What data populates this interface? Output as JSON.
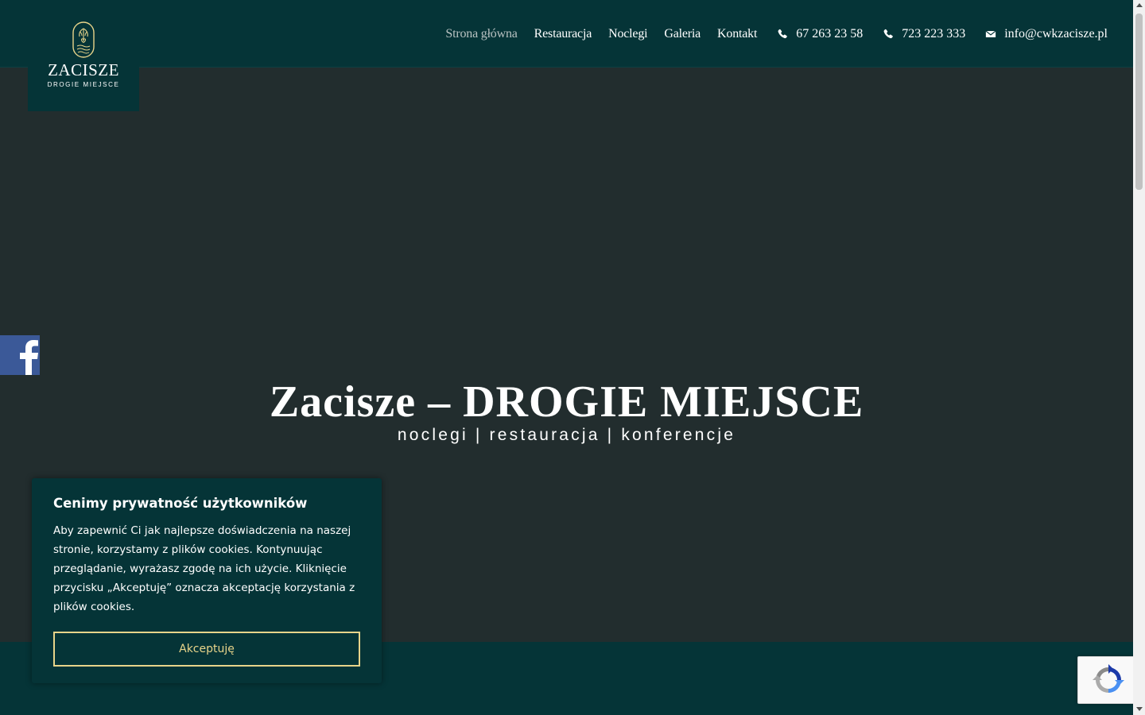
{
  "brand": {
    "name": "ZACISZE",
    "tagline": "DROGIE MIEJSCE"
  },
  "nav": {
    "items": [
      {
        "label": "Strona główna",
        "active": true
      },
      {
        "label": "Restauracja",
        "active": false
      },
      {
        "label": "Noclegi",
        "active": false
      },
      {
        "label": "Galeria",
        "active": false
      },
      {
        "label": "Kontakt",
        "active": false
      }
    ],
    "phone1": {
      "icon": "phone-icon",
      "label": "67 263 23 58"
    },
    "phone2": {
      "icon": "phone-icon",
      "label": "723 223 333"
    },
    "email": {
      "icon": "envelope-icon",
      "label": "info@cwkzacisze.pl"
    }
  },
  "hero": {
    "title": "Zacisze – DROGIE MIEJSCE",
    "subtitle": "noclegi | restauracja | konferencje"
  },
  "social": {
    "facebook_icon": "facebook-icon"
  },
  "cookie": {
    "title": "Cenimy prywatność użytkowników",
    "text": "Aby zapewnić Ci jak najlepsze doświadczenia na naszej stronie, korzystamy z plików cookies. Kontynuując przeglądanie, wyrażasz zgodę na ich użycie. Kliknięcie przycisku „Akceptuję” oznacza akceptację korzystania z plików cookies.",
    "accept_label": "Akceptuję"
  },
  "colors": {
    "header_bg": "#053437",
    "hero_bg": "#222d2e",
    "accent_gold": "#e8d48a",
    "facebook_blue": "#3b5998"
  }
}
